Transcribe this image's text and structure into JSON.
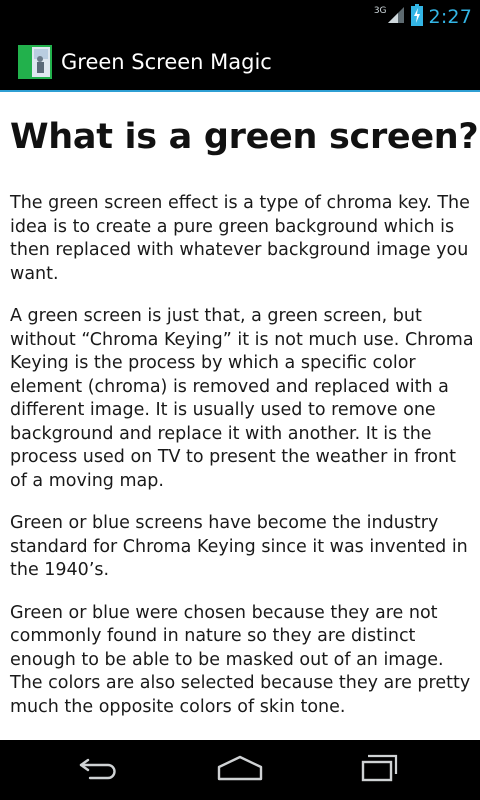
{
  "status_bar": {
    "network_type": "3G",
    "time": "2:27",
    "icons": [
      "signal-icon",
      "battery-charging-icon"
    ]
  },
  "action_bar": {
    "title": "Green Screen Magic",
    "icon": "app-icon"
  },
  "content": {
    "title": "What is a green screen?",
    "paragraphs": [
      "The green screen effect is a type of chroma key. The idea is to create a pure green background which is then replaced with whatever background image you want.",
      "A green screen is just that, a green screen, but without “Chroma Keying” it is not much use. Chroma Keying is the process by which a specific color element (chroma) is removed and replaced with a different image. It is usually used to remove one background and replace it with another. It is the process used on TV to present the weather in front of a moving map.",
      "Green or blue screens have become the industry standard for Chroma Keying since it was invented in the 1940’s.",
      "Green or blue were chosen because they are not commonly found in nature so they are distinct enough to be able to be masked out of an image. The colors are also selected because they are pretty much the opposite colors of skin tone."
    ]
  },
  "nav_bar": {
    "buttons": [
      "back-icon",
      "home-icon",
      "recent-apps-icon"
    ]
  },
  "colors": {
    "accent": "#33b5e5",
    "action_bar_divider": "#2f9fd3",
    "content_background": "#ffffff",
    "bars_background": "#000000"
  }
}
